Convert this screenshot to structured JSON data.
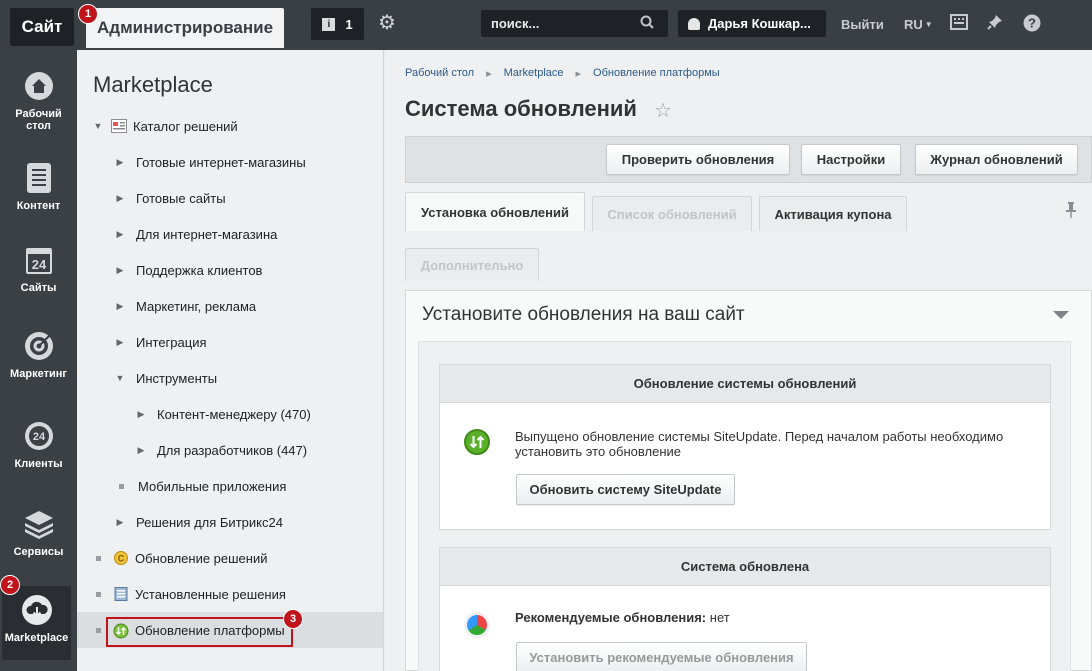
{
  "topbar": {
    "site_label": "Сайт",
    "admin_label": "Администрирование",
    "notifications_count": "1",
    "search_placeholder": "поиск...",
    "user_name": "Дарья Кошкар...",
    "logout_label": "Выйти",
    "lang_label": "RU"
  },
  "markers": [
    "1",
    "2",
    "3"
  ],
  "left_menu": {
    "items": [
      {
        "label": "Рабочий стол",
        "icon": "house-icon"
      },
      {
        "label": "Контент",
        "icon": "document-icon"
      },
      {
        "label": "Сайты",
        "icon": "calendar-24-icon"
      },
      {
        "label": "Маркетинг",
        "icon": "target-icon"
      },
      {
        "label": "Клиенты",
        "icon": "clients-24-icon"
      },
      {
        "label": "Сервисы",
        "icon": "layers-icon"
      },
      {
        "label": "Marketplace",
        "icon": "cloud-download-icon"
      }
    ]
  },
  "subnav": {
    "title": "Marketplace",
    "items": [
      {
        "label": "Каталог решений"
      },
      {
        "label": "Готовые интернет-магазины"
      },
      {
        "label": "Готовые сайты"
      },
      {
        "label": "Для интернет-магазина"
      },
      {
        "label": "Поддержка клиентов"
      },
      {
        "label": "Маркетинг, реклама"
      },
      {
        "label": "Интеграция"
      },
      {
        "label": "Инструменты"
      },
      {
        "label": "Контент-менеджеру (470)"
      },
      {
        "label": "Для разработчиков (447)"
      },
      {
        "label": "Мобильные приложения"
      },
      {
        "label": "Решения для Битрикс24"
      },
      {
        "label": "Обновление решений"
      },
      {
        "label": "Установленные решения"
      },
      {
        "label": "Обновление платформы"
      }
    ]
  },
  "breadcrumbs": [
    "Рабочий стол",
    "Marketplace",
    "Обновление платформы"
  ],
  "page_title": "Система обновлений",
  "toolbar": {
    "check_label": "Проверить обновления",
    "settings_label": "Настройки",
    "journal_label": "Журнал обновлений"
  },
  "tabs": {
    "install": "Установка обновлений",
    "list": "Список обновлений",
    "coupon": "Активация купона",
    "extra": "Дополнительно"
  },
  "panel": {
    "title": "Установите обновления на ваш сайт",
    "block1": {
      "heading": "Обновление системы обновлений",
      "text_line1": "Выпущено обновление системы SiteUpdate. Перед началом работы необходимо",
      "text_line2": "установить это обновление",
      "button": "Обновить систему SiteUpdate"
    },
    "block2": {
      "heading": "Система обновлена",
      "recommended_label": "Рекомендуемые обновления:",
      "recommended_value": "нет",
      "button": "Установить рекомендуемые обновления"
    }
  },
  "colors": {
    "marker": "#c0131b",
    "topbar": "#3a3f44",
    "leftmenu": "#3b4045"
  }
}
